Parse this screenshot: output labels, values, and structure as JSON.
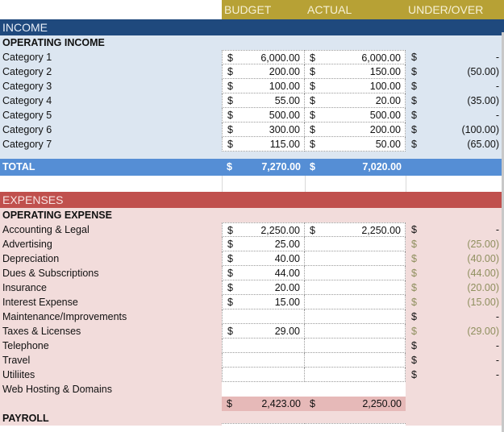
{
  "columns": {
    "budget": "BUDGET",
    "actual": "ACTUAL",
    "under_over": "UNDER/OVER"
  },
  "currency_symbol": "$",
  "income": {
    "section_title": "INCOME",
    "group_title": "OPERATING INCOME",
    "rows": [
      {
        "label": "Category 1",
        "budget": "6,000.00",
        "actual": "6,000.00",
        "under_over": "-"
      },
      {
        "label": "Category 2",
        "budget": "200.00",
        "actual": "150.00",
        "under_over": "(50.00)"
      },
      {
        "label": "Category 3",
        "budget": "100.00",
        "actual": "100.00",
        "under_over": "-"
      },
      {
        "label": "Category 4",
        "budget": "55.00",
        "actual": "20.00",
        "under_over": "(35.00)"
      },
      {
        "label": "Category 5",
        "budget": "500.00",
        "actual": "500.00",
        "under_over": "-"
      },
      {
        "label": "Category 6",
        "budget": "300.00",
        "actual": "200.00",
        "under_over": "(100.00)"
      },
      {
        "label": "Category 7",
        "budget": "115.00",
        "actual": "50.00",
        "under_over": "(65.00)"
      }
    ],
    "total": {
      "label": "TOTAL",
      "budget": "7,270.00",
      "actual": "7,020.00"
    }
  },
  "expenses": {
    "section_title": "EXPENSES",
    "group_title": "OPERATING EXPENSE",
    "rows": [
      {
        "label": "Accounting & Legal",
        "budget": "2,250.00",
        "actual": "2,250.00",
        "under_over": "-",
        "uo_muted": false
      },
      {
        "label": "Advertising",
        "budget": "25.00",
        "actual": "",
        "under_over": "(25.00)",
        "uo_muted": true
      },
      {
        "label": "Depreciation",
        "budget": "40.00",
        "actual": "",
        "under_over": "(40.00)",
        "uo_muted": true
      },
      {
        "label": "Dues & Subscriptions",
        "budget": "44.00",
        "actual": "",
        "under_over": "(44.00)",
        "uo_muted": true
      },
      {
        "label": "Insurance",
        "budget": "20.00",
        "actual": "",
        "under_over": "(20.00)",
        "uo_muted": true
      },
      {
        "label": "Interest Expense",
        "budget": "15.00",
        "actual": "",
        "under_over": "(15.00)",
        "uo_muted": true
      },
      {
        "label": "Maintenance/Improvements",
        "budget": "",
        "actual": "",
        "under_over": "-",
        "uo_muted": false
      },
      {
        "label": "Taxes & Licenses",
        "budget": "29.00",
        "actual": "",
        "under_over": "(29.00)",
        "uo_muted": true
      },
      {
        "label": "Telephone",
        "budget": "",
        "actual": "",
        "under_over": "-",
        "uo_muted": false
      },
      {
        "label": "Travel",
        "budget": "",
        "actual": "",
        "under_over": "-",
        "uo_muted": false
      },
      {
        "label": "Utiliites",
        "budget": "",
        "actual": "",
        "under_over": "-",
        "uo_muted": false
      },
      {
        "label": "Web Hosting & Domains",
        "budget": "",
        "actual": "",
        "under_over": "",
        "uo_muted": false
      }
    ],
    "subtotal": {
      "budget": "2,423.00",
      "actual": "2,250.00"
    },
    "payroll_title": "PAYROLL"
  },
  "colors": {
    "header_gold": "#b7a135",
    "income_band": "#1f497d",
    "income_bg": "#dce6f1",
    "total_band": "#558ed5",
    "expense_band": "#c0504d",
    "expense_bg": "#f2dcdb",
    "expense_subtotal": "#e6b9b8"
  }
}
